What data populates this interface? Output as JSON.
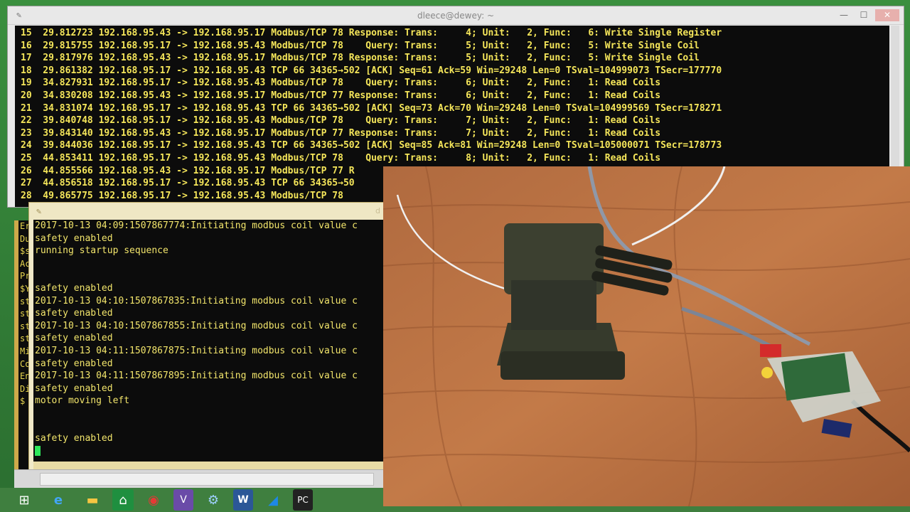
{
  "main_window": {
    "title": "dleece@dewey: ~",
    "controls": {
      "minimize": "—",
      "maximize": "☐",
      "close": "✕"
    },
    "lines": [
      "15  29.812723 192.168.95.43 -> 192.168.95.17 Modbus/TCP 78 Response: Trans:     4; Unit:   2, Func:   6: Write Single Register",
      "16  29.815755 192.168.95.17 -> 192.168.95.43 Modbus/TCP 78    Query: Trans:     5; Unit:   2, Func:   5: Write Single Coil",
      "17  29.817976 192.168.95.43 -> 192.168.95.17 Modbus/TCP 78 Response: Trans:     5; Unit:   2, Func:   5: Write Single Coil",
      "18  29.861382 192.168.95.17 -> 192.168.95.43 TCP 66 34365→502 [ACK] Seq=61 Ack=59 Win=29248 Len=0 TSval=104999073 TSecr=177770",
      "19  34.827931 192.168.95.17 -> 192.168.95.43 Modbus/TCP 78    Query: Trans:     6; Unit:   2, Func:   1: Read Coils",
      "20  34.830208 192.168.95.43 -> 192.168.95.17 Modbus/TCP 77 Response: Trans:     6; Unit:   2, Func:   1: Read Coils",
      "21  34.831074 192.168.95.17 -> 192.168.95.43 TCP 66 34365→502 [ACK] Seq=73 Ack=70 Win=29248 Len=0 TSval=104999569 TSecr=178271",
      "22  39.840748 192.168.95.17 -> 192.168.95.43 Modbus/TCP 78    Query: Trans:     7; Unit:   2, Func:   1: Read Coils",
      "23  39.843140 192.168.95.43 -> 192.168.95.17 Modbus/TCP 77 Response: Trans:     7; Unit:   2, Func:   1: Read Coils",
      "24  39.844036 192.168.95.17 -> 192.168.95.43 TCP 66 34365→502 [ACK] Seq=85 Ack=81 Win=29248 Len=0 TSval=105000071 TSecr=178773",
      "25  44.853411 192.168.95.17 -> 192.168.95.43 Modbus/TCP 78    Query: Trans:     8; Unit:   2, Func:   1: Read Coils",
      "26  44.855566 192.168.95.43 -> 192.168.95.17 Modbus/TCP 77 R",
      "27  44.856518 192.168.95.17 -> 192.168.95.43 TCP 66 34365→50",
      "28  49.865775 192.168.95.17 -> 192.168.95.43 Modbus/TCP 78"
    ]
  },
  "left_window": {
    "fragments": [
      "Er",
      "",
      "Du",
      "$s",
      "Ac",
      "Pr",
      "$Y",
      "st",
      "st",
      "st",
      "st",
      "Mi",
      "Co",
      "En",
      "",
      "Di",
      "$"
    ]
  },
  "front_window": {
    "title_tail": "d",
    "lines": [
      "2017-10-13 04:09:1507867774:Initiating modbus coil value c",
      "safety enabled",
      "running startup sequence",
      "",
      "",
      "safety enabled",
      "2017-10-13 04:10:1507867835:Initiating modbus coil value c",
      "safety enabled",
      "2017-10-13 04:10:1507867855:Initiating modbus coil value c",
      "safety enabled",
      "2017-10-13 04:11:1507867875:Initiating modbus coil value c",
      "safety enabled",
      "2017-10-13 04:11:1507867895:Initiating modbus coil value c",
      "safety enabled",
      "motor moving left",
      "",
      "",
      "safety enabled"
    ]
  },
  "taskbar": {
    "icons": [
      {
        "name": "windows-start-icon",
        "glyph": "⊞"
      },
      {
        "name": "internet-explorer-icon",
        "glyph": "e"
      },
      {
        "name": "file-explorer-icon",
        "glyph": "▬"
      },
      {
        "name": "store-icon",
        "glyph": "⌂"
      },
      {
        "name": "chrome-icon",
        "glyph": "◉"
      },
      {
        "name": "visual-studio-icon",
        "glyph": "V"
      },
      {
        "name": "network-tool-icon",
        "glyph": "⚙"
      },
      {
        "name": "word-icon",
        "glyph": "W"
      },
      {
        "name": "wireshark-icon",
        "glyph": "◢"
      },
      {
        "name": "putty-icon",
        "glyph": "PC"
      }
    ]
  },
  "colors": {
    "terminal_text": "#f5e65a",
    "cursor": "#2ee65a",
    "desktop": "#3f7f3f"
  }
}
